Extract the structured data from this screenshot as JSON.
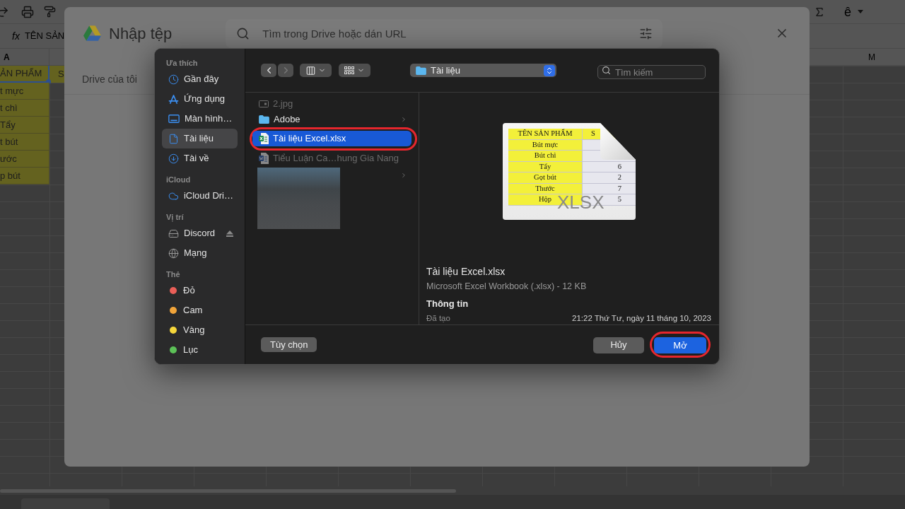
{
  "sheet": {
    "toolbar": {
      "input_tool": "ê"
    },
    "formula_bar": {
      "label": "fx",
      "value": "TÊN SẢN"
    },
    "column_headers": [
      "A",
      "M"
    ],
    "column_a": [
      {
        "text": "ẢN PHẨM",
        "selected": true
      },
      {
        "text": "t mực",
        "selected": false
      },
      {
        "text": "t chì",
        "selected": false
      },
      {
        "text": "Tẩy",
        "selected": false
      },
      {
        "text": "t bút",
        "selected": false
      },
      {
        "text": "ước",
        "selected": false
      },
      {
        "text": "p bút",
        "selected": false
      }
    ],
    "column_b": [
      {
        "text": "S"
      }
    ]
  },
  "import_dialog": {
    "title": "Nhập tệp",
    "search": {
      "placeholder": "Tìm trong Drive hoặc dán URL"
    },
    "tabs": [
      {
        "label": "Drive của tôi"
      }
    ]
  },
  "file_picker": {
    "nav": {
      "back_disabled": false,
      "forward_disabled": true
    },
    "location": "Tài liệu",
    "search": {
      "placeholder": "Tìm kiếm"
    },
    "sidebar": [
      {
        "heading": "Ưa thích",
        "items": [
          {
            "label": "Gần đây",
            "kind": "recents",
            "selected": false
          },
          {
            "label": "Ứng dụng",
            "kind": "apps",
            "selected": false
          },
          {
            "label": "Màn hình…",
            "kind": "desktop",
            "selected": false
          },
          {
            "label": "Tài liệu",
            "kind": "documents",
            "selected": true
          },
          {
            "label": "Tài về",
            "kind": "downloads",
            "selected": false
          }
        ]
      },
      {
        "heading": "iCloud",
        "items": [
          {
            "label": "iCloud Dri…",
            "kind": "cloud",
            "selected": false
          }
        ]
      },
      {
        "heading": "Vị trí",
        "items": [
          {
            "label": "Discord",
            "kind": "volume",
            "selected": false
          },
          {
            "label": "Mạng",
            "kind": "network",
            "selected": false
          }
        ]
      },
      {
        "heading": "Thẻ",
        "items": [
          {
            "label": "Đỏ",
            "kind": "tag",
            "color": "#ea5f58",
            "selected": false
          },
          {
            "label": "Cam",
            "kind": "tag",
            "color": "#f0a43a",
            "selected": false
          },
          {
            "label": "Vàng",
            "kind": "tag",
            "color": "#f5d63b",
            "selected": false
          },
          {
            "label": "Lục",
            "kind": "tag",
            "color": "#5cc157",
            "selected": false
          }
        ]
      }
    ],
    "files": [
      {
        "name": "2.jpg",
        "kind": "image",
        "selected": false,
        "disabled": true,
        "highlighted": false
      },
      {
        "name": "Adobe",
        "kind": "folder",
        "selected": false,
        "disabled": false,
        "highlighted": false
      },
      {
        "name": "Tài liệu Excel.xlsx",
        "kind": "spreadsheet",
        "selected": true,
        "disabled": false,
        "highlighted": true
      },
      {
        "name": "Tiểu Luận Ca…hung Gia Nang",
        "kind": "document",
        "selected": false,
        "disabled": true,
        "highlighted": false
      },
      {
        "kind": "blurred"
      }
    ],
    "preview": {
      "thumbnail": {
        "header": [
          "TÊN SẢN PHẨM",
          "S"
        ],
        "rows": [
          [
            "Bút mực"
          ],
          [
            "Bút chì"
          ],
          [
            "Tẩy",
            "6"
          ],
          [
            "Gọt bút",
            "2"
          ],
          [
            "Thước",
            "7"
          ],
          [
            "Hộp",
            "5"
          ]
        ],
        "label": "XLSX"
      },
      "name": "Tài liệu Excel.xlsx",
      "description": "Microsoft Excel Workbook (.xlsx) - 12 KB",
      "info_heading": "Thông tin",
      "info": [
        {
          "label": "Đã tạo",
          "value": "21:22 Thứ Tư, ngày 11 tháng 10, 2023"
        }
      ]
    },
    "options_button": {
      "label": "Tùy chọn"
    },
    "buttons": [
      {
        "label": "Hủy",
        "kind": "secondary",
        "highlighted": false
      },
      {
        "label": "Mở",
        "kind": "primary",
        "highlighted": true
      }
    ]
  }
}
